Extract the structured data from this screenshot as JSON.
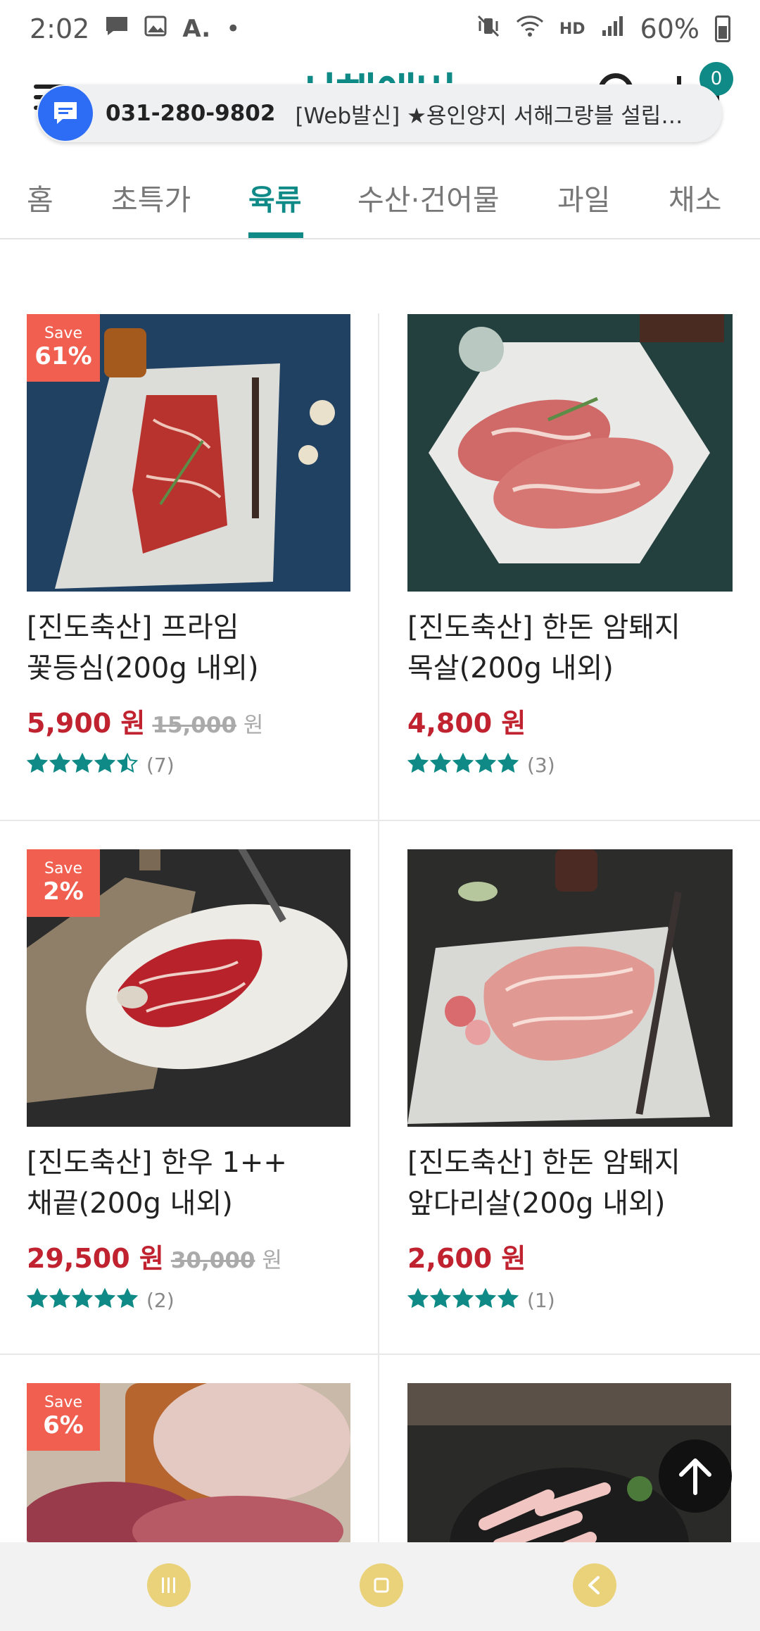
{
  "status_bar": {
    "time": "2:02",
    "battery": "60%",
    "hd_label": "HD"
  },
  "header": {
    "logo_text": "서해애버",
    "cart_count": "0"
  },
  "call_toast": {
    "number": "031-280-9802",
    "text": "[Web발신] ★용인양지 서해그랑블 설립인가..."
  },
  "tabs": [
    {
      "label": "홈",
      "active": false
    },
    {
      "label": "초특가",
      "active": false
    },
    {
      "label": "육류",
      "active": true
    },
    {
      "label": "수산·건어물",
      "active": false
    },
    {
      "label": "과일",
      "active": false
    },
    {
      "label": "채소",
      "active": false
    }
  ],
  "products": [
    {
      "save_label": "Save",
      "save_percent": "61%",
      "title_line1": "[진도축산] 프라임",
      "title_line2": "꽃등심(200g 내외)",
      "price": "5,900 원",
      "orig_price": "15,000",
      "orig_unit": "원",
      "rating": 4.5,
      "review_count": "(7)"
    },
    {
      "save_label": "",
      "save_percent": "",
      "title_line1": "[진도축산] 한돈 암퇘지",
      "title_line2": "목살(200g 내외)",
      "price": "4,800 원",
      "orig_price": "",
      "orig_unit": "",
      "rating": 5,
      "review_count": "(3)"
    },
    {
      "save_label": "Save",
      "save_percent": "2%",
      "title_line1": "[진도축산] 한우 1++",
      "title_line2": "채끝(200g 내외)",
      "price": "29,500 원",
      "orig_price": "30,000",
      "orig_unit": "원",
      "rating": 5,
      "review_count": "(2)"
    },
    {
      "save_label": "",
      "save_percent": "",
      "title_line1": "[진도축산] 한돈 암퇘지",
      "title_line2": "앞다리살(200g 내외)",
      "price": "2,600 원",
      "orig_price": "",
      "orig_unit": "",
      "rating": 5,
      "review_count": "(1)"
    },
    {
      "save_label": "Save",
      "save_percent": "6%"
    },
    {
      "save_label": "",
      "save_percent": ""
    }
  ],
  "colors": {
    "accent": "#0f8a86",
    "price_red": "#c0232f",
    "save_badge": "#f05f4f",
    "star": "#0f8a86"
  }
}
